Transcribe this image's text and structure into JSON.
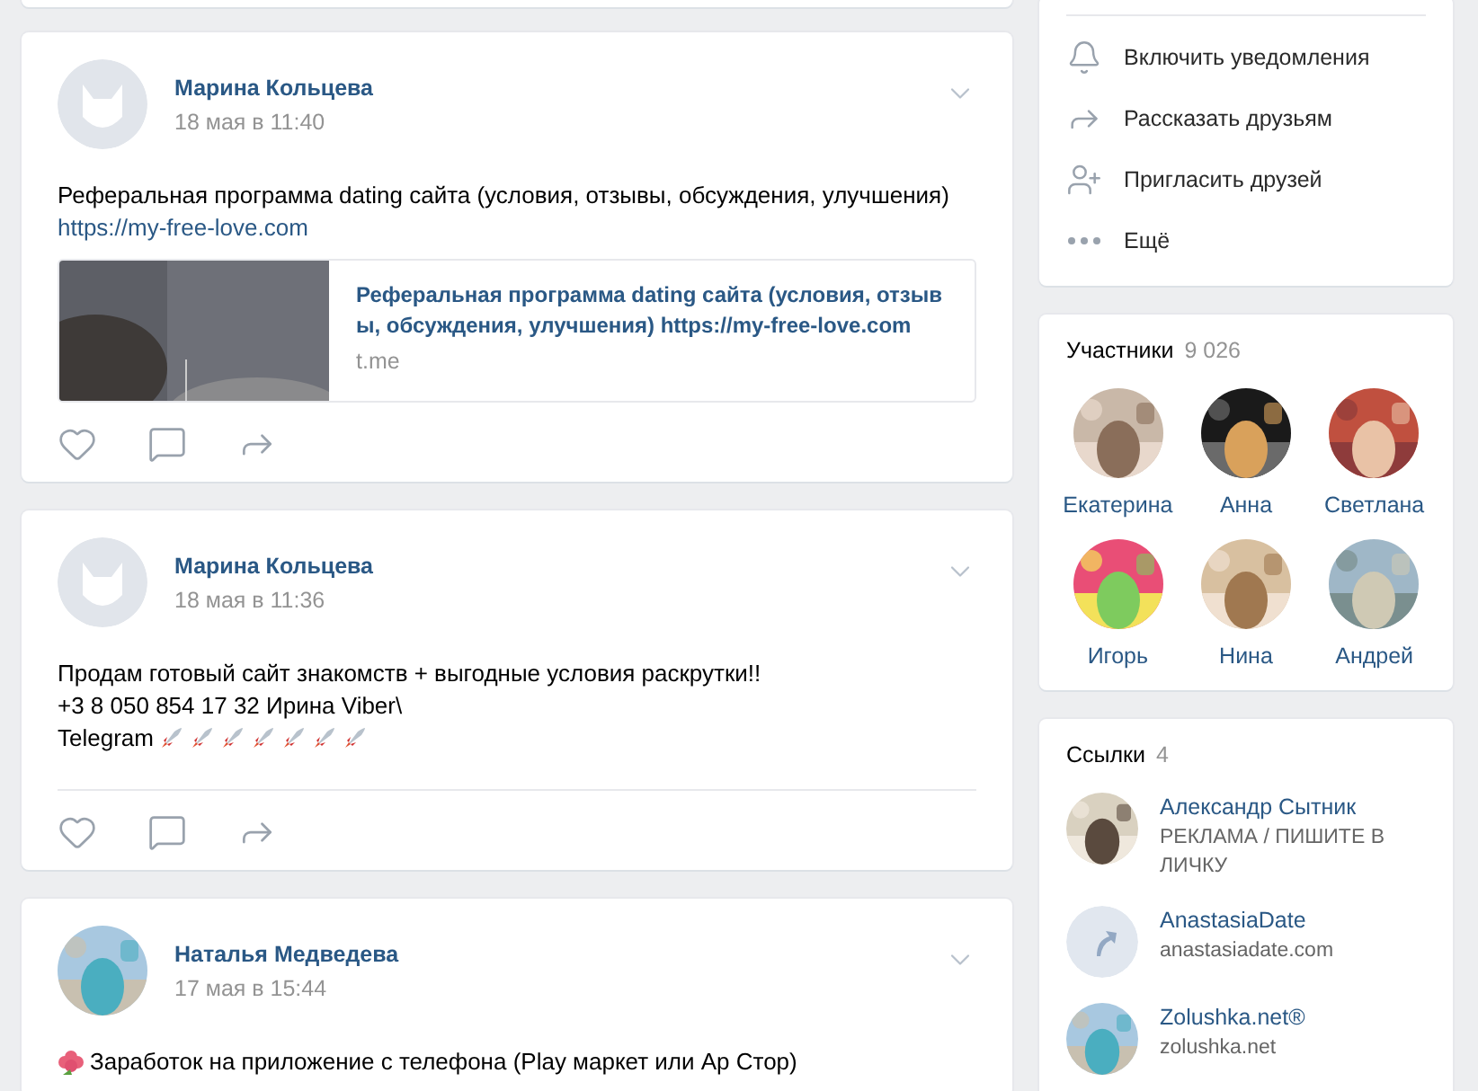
{
  "posts": [
    {
      "author": "Марина Кольцева",
      "date": "18 мая в 11:40",
      "avatar": {
        "kind": "default"
      },
      "lines": [
        {
          "text": "Реферальная программа dating сайта (условия, отзывы, обсуждения, улучшения)"
        },
        {
          "text": "https://my-free-love.com",
          "kind": "link"
        }
      ],
      "attachment": {
        "title": "Реферальная программа dating сайта (условия, отзывы, обсуждения, улучшения) https://my-free-love.com",
        "domain": "t.me"
      },
      "divider": false
    },
    {
      "author": "Марина Кольцева",
      "date": "18 мая в 11:36",
      "avatar": {
        "kind": "default"
      },
      "lines": [
        {
          "text": "Продам готовый сайт знакомств + выгодные условия раскрутки!!"
        },
        {
          "text": "+3 8 050 854 17 32 Ирина Viber\\"
        },
        {
          "text": "Telegram",
          "icons_after": [
            {
              "kind": "rocket"
            },
            {
              "kind": "rocket"
            },
            {
              "kind": "rocket"
            },
            {
              "kind": "rocket"
            },
            {
              "kind": "rocket"
            },
            {
              "kind": "rocket"
            },
            {
              "kind": "rocket"
            }
          ]
        }
      ],
      "divider": true
    },
    {
      "author": "Наталья Медведева",
      "date": "17 мая в 15:44",
      "avatar": {
        "kind": "picture"
      },
      "lines": [
        {
          "text": "Заработок на приложение с телефона (Play маркет или Ар Стор)",
          "icons_before": [
            {
              "kind": "flower"
            }
          ]
        }
      ]
    }
  ],
  "actions": [
    {
      "kind": "bell",
      "label": "Включить уведомления"
    },
    {
      "kind": "share",
      "label": "Рассказать друзьям"
    },
    {
      "kind": "invite",
      "label": "Пригласить друзей"
    },
    {
      "kind": "more",
      "label": "Ещё"
    }
  ],
  "members": {
    "title": "Участники",
    "count": "9 026",
    "items": [
      {
        "name": "Екатерина"
      },
      {
        "name": "Анна"
      },
      {
        "name": "Светлана"
      },
      {
        "name": "Игорь"
      },
      {
        "name": "Нина"
      },
      {
        "name": "Андрей"
      }
    ]
  },
  "links": {
    "title": "Ссылки",
    "count": "4",
    "items": [
      {
        "title": "Александр Сытник",
        "subtitle": "РЕКЛАМА / ПИШИТЕ В ЛИЧКУ",
        "avatar": {
          "kind": "picture"
        }
      },
      {
        "title": "AnastasiaDate",
        "subtitle": "anastasiadate.com",
        "avatar": {
          "kind": "link"
        }
      },
      {
        "title": "Zolushka.net®",
        "subtitle": "zolushka.net",
        "avatar": {
          "kind": "picture"
        }
      }
    ]
  }
}
